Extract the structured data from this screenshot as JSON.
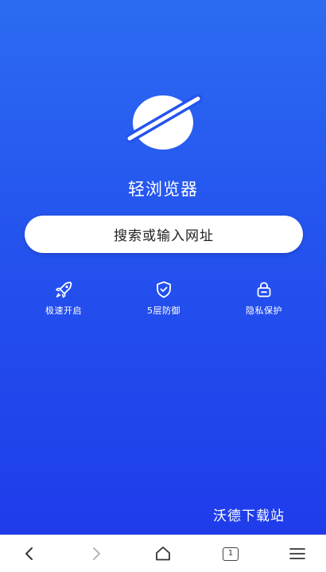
{
  "app": {
    "title": "轻浏览器"
  },
  "search": {
    "placeholder": "搜索或输入网址"
  },
  "features": [
    {
      "icon": "rocket-icon",
      "label": "极速开启"
    },
    {
      "icon": "shield-check-icon",
      "label": "5层防御"
    },
    {
      "icon": "lock-icon",
      "label": "隐私保护"
    }
  ],
  "watermark": "沃德下载站",
  "navbar": {
    "tab_count": "1",
    "items": [
      "back-icon",
      "forward-icon",
      "home-icon",
      "tabs-icon",
      "menu-icon"
    ]
  },
  "colors": {
    "background_top": "#2c6bf2",
    "background_bottom": "#1f3ceb",
    "accent": "#2453ee"
  }
}
